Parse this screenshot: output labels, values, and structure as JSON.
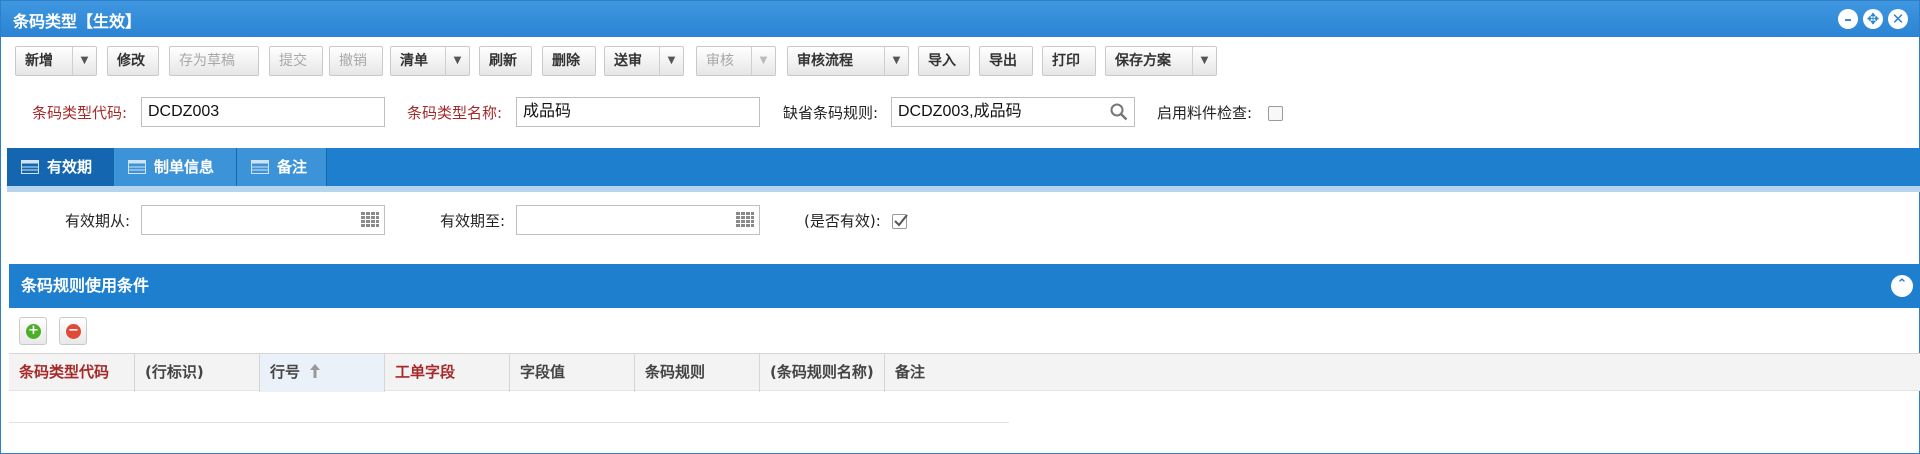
{
  "window": {
    "title": "条码类型【生效】",
    "controls": [
      "minimize-icon",
      "restore-icon",
      "close-icon"
    ]
  },
  "toolbar": {
    "new": "新增",
    "modify": "修改",
    "save_draft": "存为草稿",
    "submit": "提交",
    "undo": "撤销",
    "clear": "清单",
    "refresh": "刷新",
    "delete": "删除",
    "send_review": "送审",
    "review": "审核",
    "review_flow": "审核流程",
    "import": "导入",
    "export": "导出",
    "print": "打印",
    "save_scheme": "保存方案"
  },
  "form": {
    "code_label": "条码类型代码:",
    "code_value": "DCDZ003",
    "name_label": "条码类型名称:",
    "name_value": "成品码",
    "rule_label": "缺省条码规则:",
    "rule_value": "DCDZ003,成品码",
    "enable_check_label": "启用料件检查:",
    "enable_check": false
  },
  "tabs": [
    {
      "label": "有效期",
      "active": true
    },
    {
      "label": "制单信息",
      "active": false
    },
    {
      "label": "备注",
      "active": false
    }
  ],
  "validity": {
    "from_label": "有效期从:",
    "from_value": "",
    "to_label": "有效期至:",
    "to_value": "",
    "is_valid_label": "(是否有效):",
    "is_valid": true
  },
  "section": {
    "title": "条码规则使用条件"
  },
  "grid": {
    "columns": [
      {
        "label": "条码类型代码",
        "required": true
      },
      {
        "label": "(行标识)",
        "required": false
      },
      {
        "label": "行号",
        "required": false,
        "sorted": "asc"
      },
      {
        "label": "工单字段",
        "required": true
      },
      {
        "label": "字段值",
        "required": false
      },
      {
        "label": "条码规则",
        "required": false
      },
      {
        "label": "(条码规则名称)",
        "required": false
      },
      {
        "label": "备注",
        "required": false
      }
    ],
    "rows": []
  },
  "colors": {
    "title_bar": "#2b84d3",
    "tab_bar": "#1f7fcf",
    "required_label": "#a52a2a",
    "add_button": "#4caf28",
    "remove_button": "#e04a3a"
  }
}
